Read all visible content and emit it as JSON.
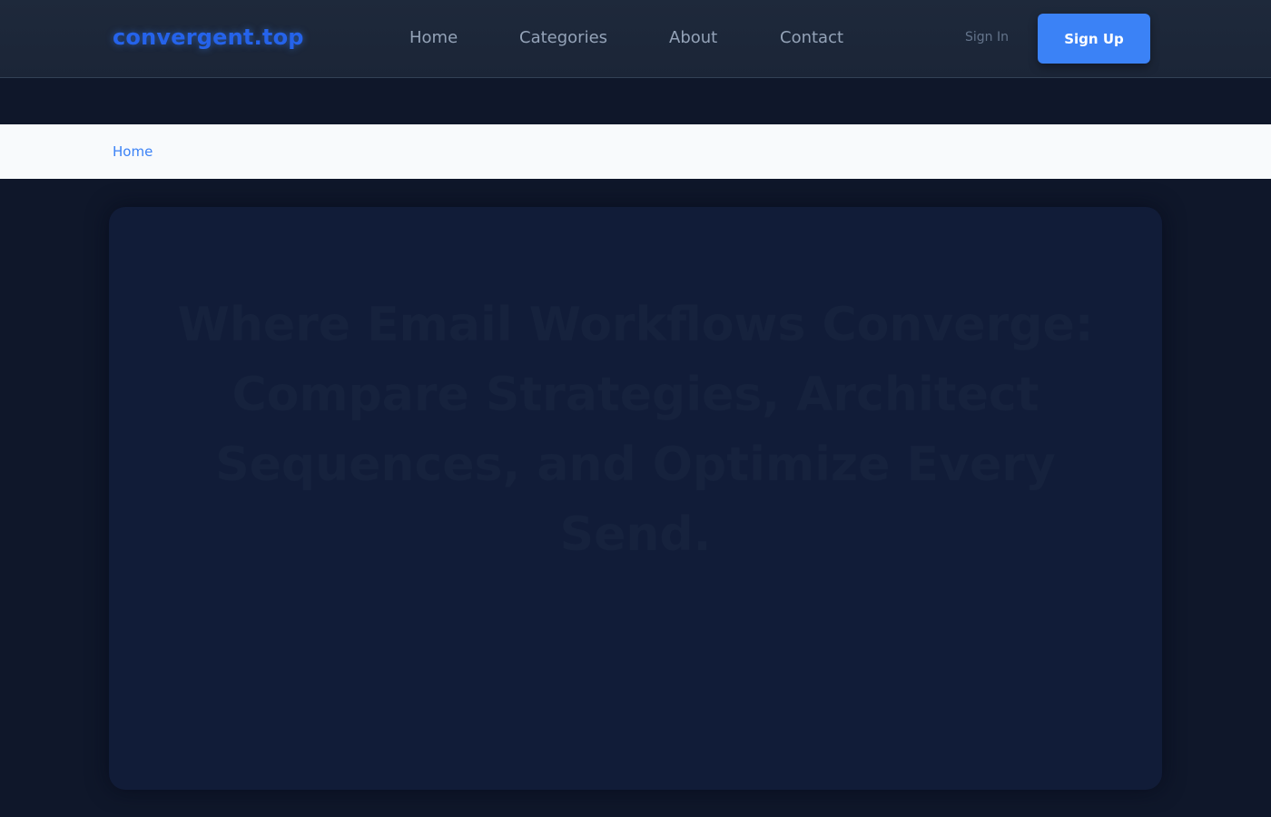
{
  "header": {
    "logo": "convergent.top",
    "nav": [
      {
        "label": "Home"
      },
      {
        "label": "Categories"
      },
      {
        "label": "About"
      },
      {
        "label": "Contact"
      }
    ],
    "sign_in": "Sign In",
    "sign_up": "Sign Up"
  },
  "breadcrumb": {
    "home": "Home"
  },
  "hero": {
    "title": "Where Email Workflows Converge: Compare Strategies, Architect Sequences, and Optimize Every Send."
  },
  "colors": {
    "page_background": "#0f172a",
    "header_background": "#1e293b",
    "accent": "#3b82f6",
    "logo": "#2563eb",
    "breadcrumb_background": "#f8fafc",
    "hero_card": "#111c38"
  }
}
